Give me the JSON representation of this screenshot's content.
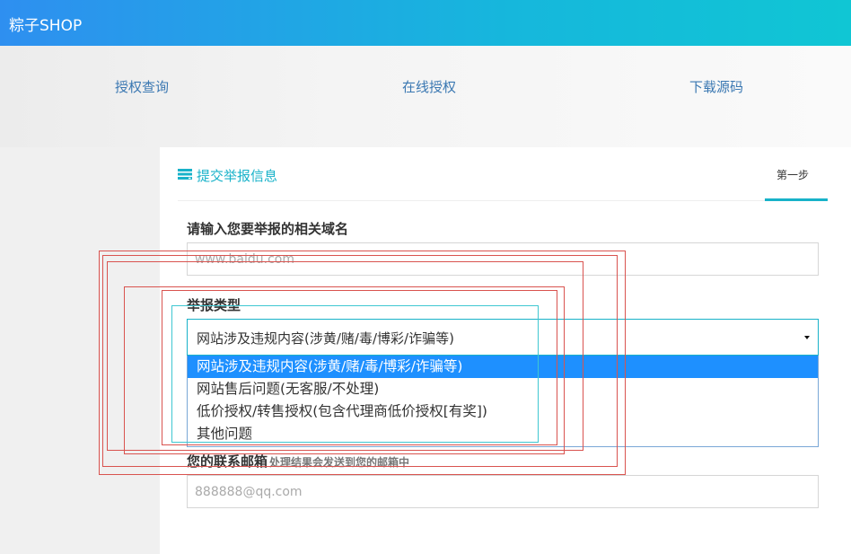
{
  "brand": "粽子SHOP",
  "nav": [
    "授权查询",
    "在线授权",
    "下载源码"
  ],
  "card": {
    "title": "提交举报信息",
    "step": "第一步"
  },
  "form": {
    "domain_label": "请输入您要举报的相关域名",
    "domain_placeholder": "www.baidu.com",
    "type_label": "举报类型",
    "type_value": "网站涉及违规内容(涉黄/赌/毒/博彩/诈骗等)",
    "type_options": [
      "网站涉及违规内容(涉黄/赌/毒/博彩/诈骗等)",
      "网站售后问题(无客服/不处理)",
      "低价授权/转售授权(包含代理商低价授权[有奖])",
      "其他问题"
    ],
    "email_label": "您的联系邮箱",
    "email_hint": "处理结果会发送到您的邮箱中",
    "email_placeholder": "888888@qq.com"
  },
  "colors": {
    "accent": "#18b2c9",
    "header_start": "#2e8ff0",
    "header_end": "#10c6d4",
    "nav_link": "#3b78b2",
    "selected_option": "#1e90ff"
  },
  "icons": {
    "card_title": "form-list-icon",
    "select": "caret-down-icon"
  }
}
